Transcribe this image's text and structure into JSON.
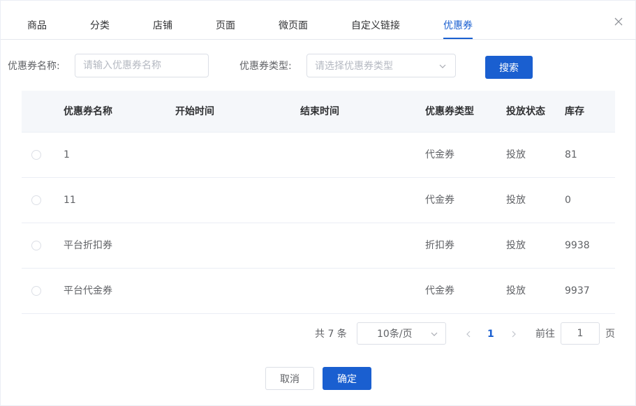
{
  "tabs": [
    {
      "label": "商品"
    },
    {
      "label": "分类"
    },
    {
      "label": "店铺"
    },
    {
      "label": "页面"
    },
    {
      "label": "微页面"
    },
    {
      "label": "自定义链接"
    },
    {
      "label": "优惠券"
    }
  ],
  "active_tab": "优惠券",
  "filters": {
    "name_label": "优惠券名称:",
    "name_placeholder": "请输入优惠券名称",
    "type_label": "优惠券类型:",
    "type_placeholder": "请选择优惠券类型",
    "search_label": "搜索"
  },
  "table": {
    "columns": [
      "优惠券名称",
      "开始时间",
      "结束时间",
      "优惠券类型",
      "投放状态",
      "库存"
    ],
    "rows": [
      {
        "name": "1",
        "start": "",
        "end": "",
        "type": "代金券",
        "status": "投放",
        "stock": "81"
      },
      {
        "name": "11",
        "start": "",
        "end": "",
        "type": "代金券",
        "status": "投放",
        "stock": "0"
      },
      {
        "name": "平台折扣券",
        "start": "",
        "end": "",
        "type": "折扣券",
        "status": "投放",
        "stock": "9938"
      },
      {
        "name": "平台代金券",
        "start": "",
        "end": "",
        "type": "代金券",
        "status": "投放",
        "stock": "9937"
      }
    ]
  },
  "pagination": {
    "total_text": "共 7 条",
    "page_size": "10条/页",
    "current_page": "1",
    "goto_label": "前往",
    "goto_value": "1",
    "page_suffix": "页"
  },
  "footer": {
    "cancel_label": "取消",
    "confirm_label": "确定"
  },
  "icons": {
    "close": "close-icon",
    "chevron": "chevron-down-icon",
    "prev": "chevron-left-icon",
    "next": "chevron-right-icon"
  },
  "colors": {
    "accent": "#1a5fd0",
    "border": "#dcdfe6",
    "header_bg": "#f5f7fa"
  }
}
